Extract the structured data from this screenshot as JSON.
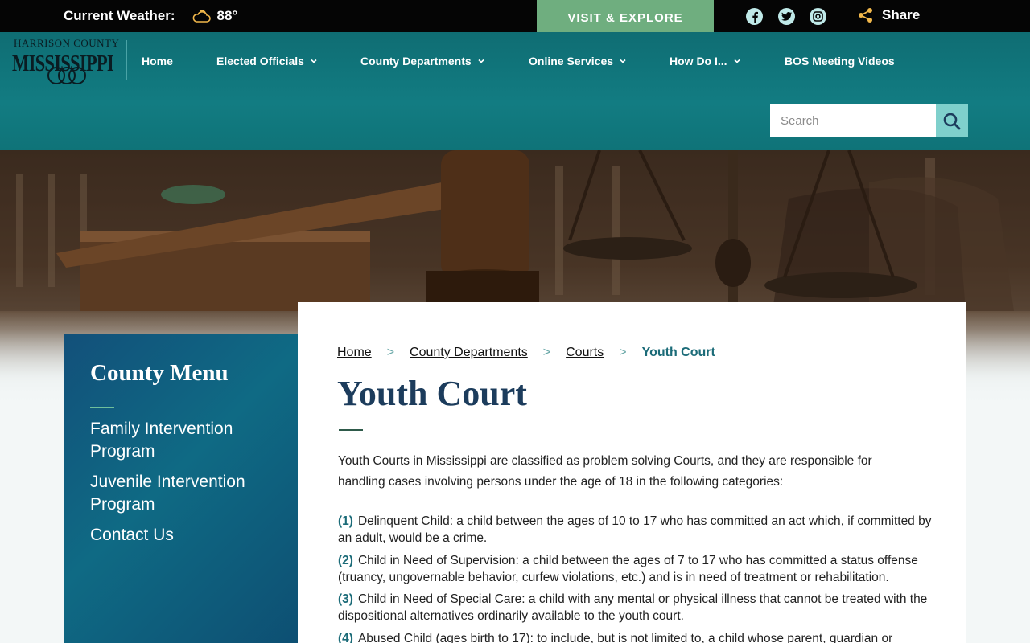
{
  "topbar": {
    "weather_label": "Current Weather:",
    "weather_icon": "partly-cloudy-icon",
    "temperature": "88°",
    "visit_label": "VISIT & EXPLORE",
    "social_icons": [
      "facebook-icon",
      "twitter-icon",
      "instagram-icon"
    ],
    "share_label": "Share"
  },
  "logo": {
    "top_text": "HARRISON COUNTY",
    "main_text": "MISSISSIPPI"
  },
  "nav": {
    "items": [
      {
        "label": "Home",
        "dropdown": false
      },
      {
        "label": "Elected Officials",
        "dropdown": true
      },
      {
        "label": "County Departments",
        "dropdown": true
      },
      {
        "label": "Online Services",
        "dropdown": true
      },
      {
        "label": "How Do I...",
        "dropdown": true
      },
      {
        "label": "BOS Meeting Videos",
        "dropdown": false
      }
    ]
  },
  "search": {
    "placeholder": "Search",
    "value": ""
  },
  "sidebar": {
    "title": "County Menu",
    "links": [
      "Family Intervention Program",
      "Juvenile Intervention Program",
      "Contact Us"
    ]
  },
  "breadcrumb": {
    "items": [
      "Home",
      "County Departments",
      "Courts"
    ],
    "separator": ">",
    "current": "Youth Court"
  },
  "page": {
    "title": "Youth Court",
    "intro": "Youth Courts in Mississippi are classified as problem solving Courts, and they are responsible for handling cases involving persons under the age of 18 in the following categories:",
    "categories": [
      {
        "num": "(1)",
        "text": "Delinquent Child: a child between the ages of 10 to 17 who has committed an act which, if committed by an adult, would be a crime."
      },
      {
        "num": "(2)",
        "text": "Child in Need of Supervision: a child between the ages of 7 to 17 who has committed a status offense (truancy, ungovernable behavior, curfew violations, etc.) and is in need of treatment or rehabilitation."
      },
      {
        "num": "(3)",
        "text": "Child in Need of Special Care: a child with any mental or physical illness that cannot be treated with the dispositional alternatives ordinarily available to the youth court."
      },
      {
        "num": "(4)",
        "text": "Abused Child (ages birth to 17): to include, but is not limited to, a child whose parent, guardian or"
      }
    ]
  },
  "colors": {
    "header_teal": "#127c82",
    "visit_green": "#6fae7f",
    "title_navy": "#1c3c5c",
    "accent_teal": "#1b6b78",
    "search_button": "#7fd0cc"
  }
}
